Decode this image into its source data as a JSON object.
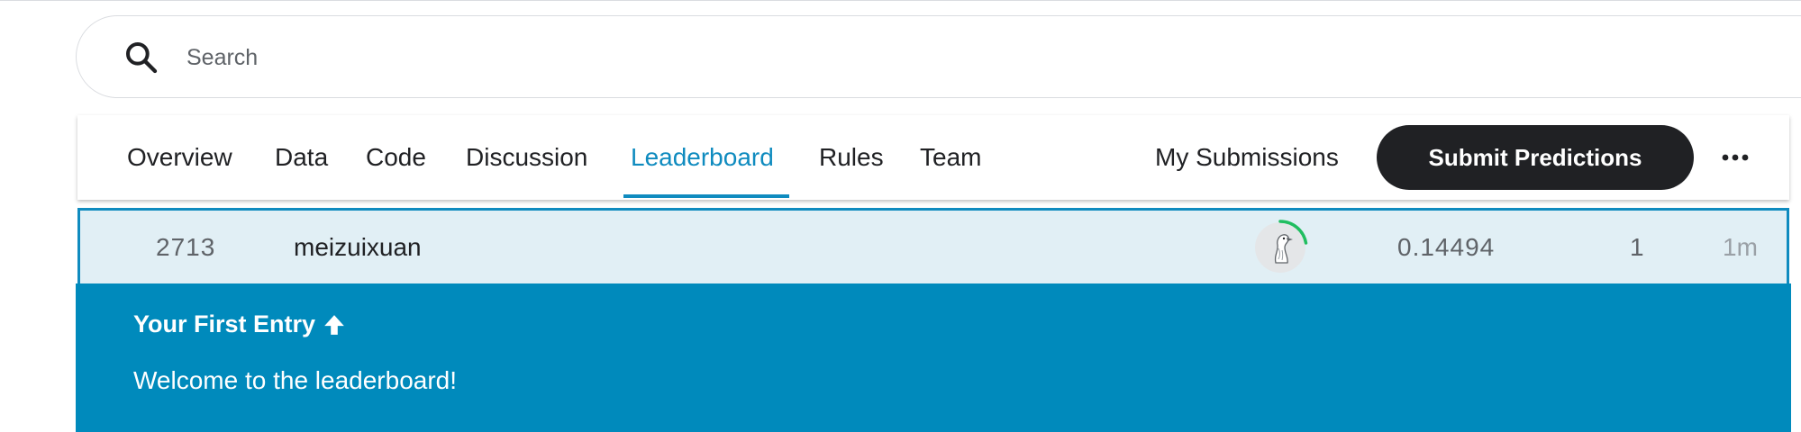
{
  "search": {
    "placeholder": "Search",
    "icon": "search-icon"
  },
  "tabs": [
    {
      "label": "Overview",
      "active": false
    },
    {
      "label": "Data",
      "active": false
    },
    {
      "label": "Code",
      "active": false
    },
    {
      "label": "Discussion",
      "active": false
    },
    {
      "label": "Leaderboard",
      "active": true
    },
    {
      "label": "Rules",
      "active": false
    },
    {
      "label": "Team",
      "active": false
    }
  ],
  "actions": {
    "my_submissions": "My Submissions",
    "submit": "Submit Predictions",
    "more_icon": "more-horizontal-icon"
  },
  "leaderboard_row": {
    "rank": "2713",
    "team": "meizuixuan",
    "score": "0.14494",
    "entries": "1",
    "last": "1m",
    "avatar_icon": "goose-avatar",
    "avatar_progress": 0.25
  },
  "banner": {
    "title": "Your First Entry",
    "title_icon": "up-arrow-icon",
    "message": "Welcome to the leaderboard!"
  },
  "colors": {
    "accent": "#0f8bbf",
    "banner": "#008abc",
    "row_highlight": "#e1eff5",
    "button": "#202124",
    "progress": "#20be60"
  }
}
